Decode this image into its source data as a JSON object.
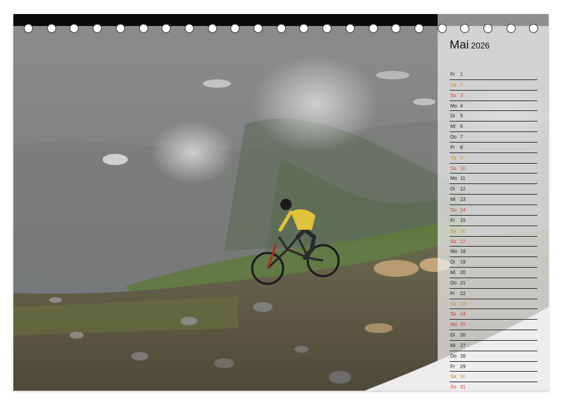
{
  "calendar": {
    "month": "Mai",
    "year": "2026",
    "days": [
      {
        "wd": "Fr",
        "d": "1",
        "kind": "friday"
      },
      {
        "wd": "Sa",
        "d": "2",
        "kind": "saturday"
      },
      {
        "wd": "So",
        "d": "3",
        "kind": "sunday"
      },
      {
        "wd": "Mo",
        "d": "4",
        "kind": "weekday"
      },
      {
        "wd": "Di",
        "d": "5",
        "kind": "weekday"
      },
      {
        "wd": "Mi",
        "d": "6",
        "kind": "weekday"
      },
      {
        "wd": "Do",
        "d": "7",
        "kind": "weekday"
      },
      {
        "wd": "Fr",
        "d": "8",
        "kind": "friday"
      },
      {
        "wd": "Sa",
        "d": "9",
        "kind": "saturday"
      },
      {
        "wd": "So",
        "d": "10",
        "kind": "sunday"
      },
      {
        "wd": "Mo",
        "d": "11",
        "kind": "weekday"
      },
      {
        "wd": "Di",
        "d": "12",
        "kind": "weekday"
      },
      {
        "wd": "Mi",
        "d": "13",
        "kind": "weekday"
      },
      {
        "wd": "Do",
        "d": "14",
        "kind": "sunday"
      },
      {
        "wd": "Fr",
        "d": "15",
        "kind": "friday"
      },
      {
        "wd": "Sa",
        "d": "16",
        "kind": "saturday"
      },
      {
        "wd": "So",
        "d": "17",
        "kind": "sunday"
      },
      {
        "wd": "Mo",
        "d": "18",
        "kind": "weekday"
      },
      {
        "wd": "Di",
        "d": "19",
        "kind": "weekday"
      },
      {
        "wd": "Mi",
        "d": "20",
        "kind": "weekday"
      },
      {
        "wd": "Do",
        "d": "21",
        "kind": "weekday"
      },
      {
        "wd": "Fr",
        "d": "22",
        "kind": "friday"
      },
      {
        "wd": "Sa",
        "d": "23",
        "kind": "saturday"
      },
      {
        "wd": "So",
        "d": "24",
        "kind": "sunday"
      },
      {
        "wd": "Mo",
        "d": "25",
        "kind": "sunday"
      },
      {
        "wd": "Di",
        "d": "26",
        "kind": "weekday"
      },
      {
        "wd": "Mi",
        "d": "27",
        "kind": "weekday"
      },
      {
        "wd": "Do",
        "d": "28",
        "kind": "weekday"
      },
      {
        "wd": "Fr",
        "d": "29",
        "kind": "friday"
      },
      {
        "wd": "Sa",
        "d": "30",
        "kind": "saturday"
      },
      {
        "wd": "So",
        "d": "31",
        "kind": "sunday"
      }
    ]
  },
  "colors": {
    "saturday": "#d98a1f",
    "sunday_holiday": "#d83a2a",
    "weekday": "#1a1a1a",
    "binding": "#0a0a0a"
  },
  "photo": {
    "subject": "mountain-biker-descending-alpine-slope"
  }
}
